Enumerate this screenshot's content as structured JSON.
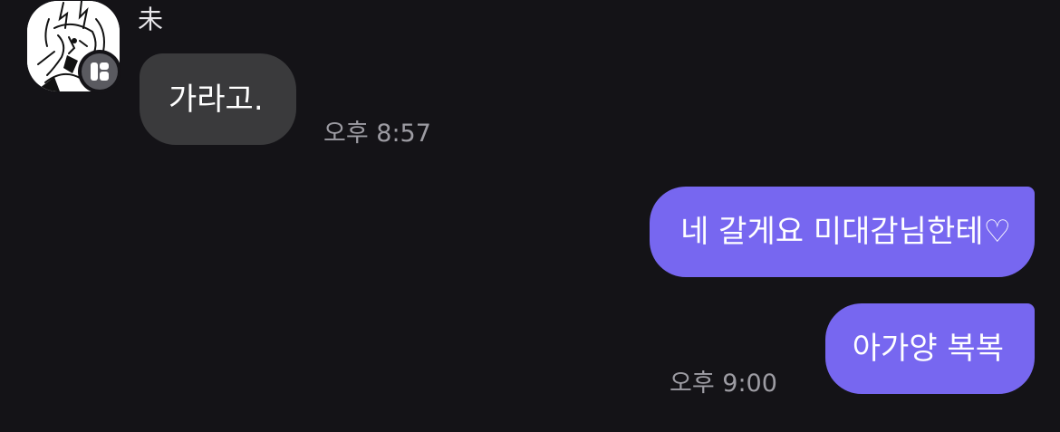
{
  "chat": {
    "incoming": {
      "sender_name": "未",
      "message": "가라고.",
      "time": "오후 8:57"
    },
    "outgoing": [
      {
        "message": "네 갈게요 미대감님한테♡"
      },
      {
        "message": "아가양 복복",
        "time": "오후 9:00"
      }
    ]
  },
  "icons": {
    "avatar": "manga-character-avatar",
    "badge": "app-badge-icon"
  },
  "colors": {
    "background": "#141317",
    "incoming_bubble": "#3a3a3c",
    "outgoing_bubble": "#7767f0",
    "timestamp": "#9d9ca3"
  }
}
